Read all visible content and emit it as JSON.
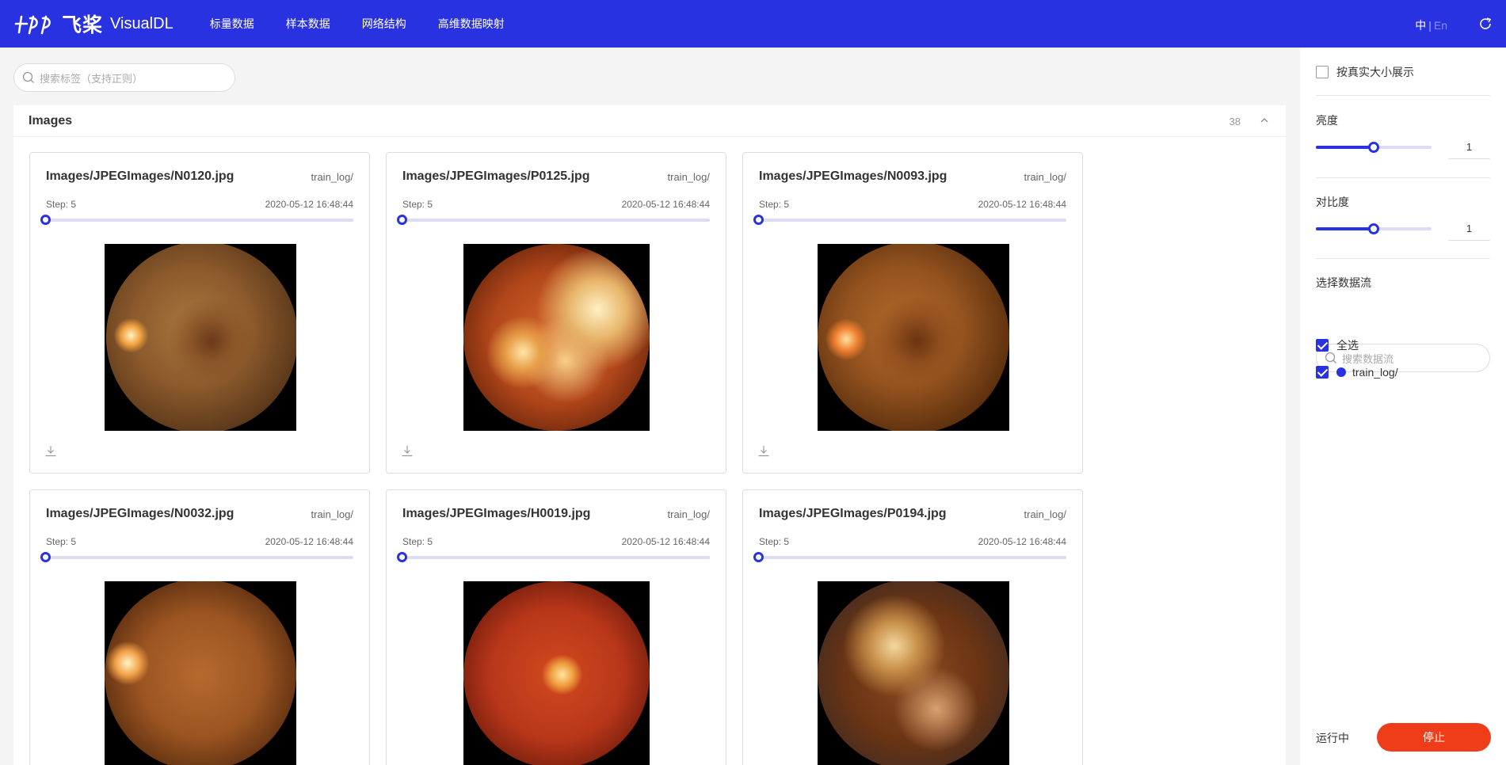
{
  "header": {
    "brand_cn": "飞桨",
    "brand_en": "VisualDL",
    "nav": [
      "标量数据",
      "样本数据",
      "网络结构",
      "高维数据映射"
    ],
    "lang_cn": "中",
    "lang_sep": "|",
    "lang_en": "En",
    "bg_color": "#2932e1"
  },
  "search": {
    "placeholder": "搜索标签（支持正则）"
  },
  "panel": {
    "title": "Images",
    "count": "38",
    "cards": [
      {
        "title": "Images/JPEGImages/N0120.jpg",
        "run": "train_log/",
        "step": "Step: 5",
        "time": "2020-05-12 16:48:44"
      },
      {
        "title": "Images/JPEGImages/P0125.jpg",
        "run": "train_log/",
        "step": "Step: 5",
        "time": "2020-05-12 16:48:44"
      },
      {
        "title": "Images/JPEGImages/N0093.jpg",
        "run": "train_log/",
        "step": "Step: 5",
        "time": "2020-05-12 16:48:44"
      },
      {
        "title": "Images/JPEGImages/N0032.jpg",
        "run": "train_log/",
        "step": "Step: 5",
        "time": "2020-05-12 16:48:44"
      },
      {
        "title": "Images/JPEGImages/H0019.jpg",
        "run": "train_log/",
        "step": "Step: 5",
        "time": "2020-05-12 16:48:44"
      },
      {
        "title": "Images/JPEGImages/P0194.jpg",
        "run": "train_log/",
        "step": "Step: 5",
        "time": "2020-05-12 16:48:44"
      }
    ]
  },
  "sidebar": {
    "actual_size_label": "按真实大小展示",
    "brightness_label": "亮度",
    "brightness_value": "1",
    "brightness_fraction": 0.5,
    "contrast_label": "对比度",
    "contrast_value": "1",
    "contrast_fraction": 0.5,
    "runs_label": "选择数据流",
    "runs_search_placeholder": "搜索数据流",
    "select_all_label": "全选",
    "run_name": "train_log/",
    "status": "运行中",
    "stop_label": "停止",
    "accent_color": "#2932e1",
    "stop_color": "#f03d19"
  }
}
